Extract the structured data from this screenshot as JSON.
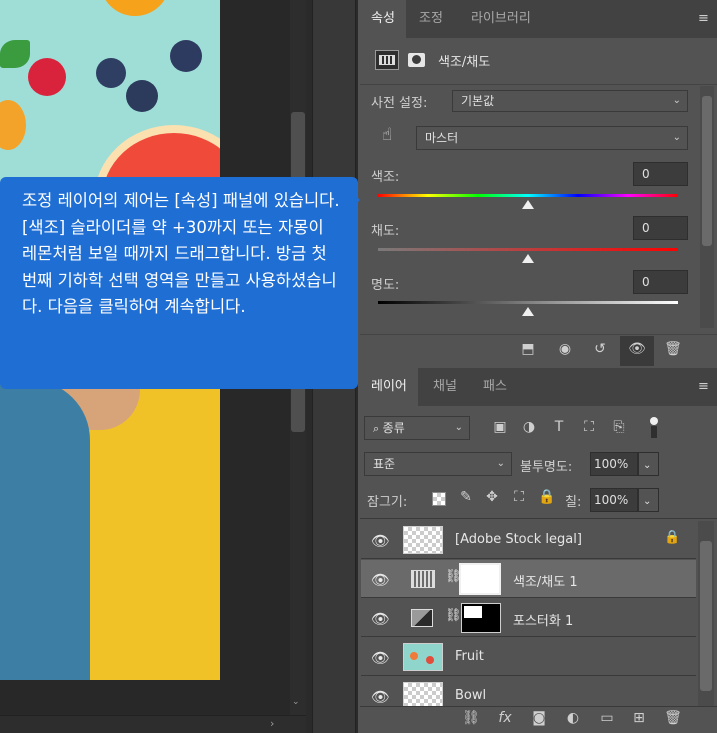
{
  "properties": {
    "tabs": [
      "속성",
      "조정",
      "라이브러리"
    ],
    "title": "색조/채도",
    "preset_label": "사전 설정:",
    "preset_value": "기본값",
    "channel_value": "마스터",
    "hue_label": "색조:",
    "hue_value": "0",
    "saturation_label": "채도:",
    "saturation_value": "0",
    "lightness_label": "명도:",
    "lightness_value": "0"
  },
  "layers_panel": {
    "tabs": [
      "레이어",
      "채널",
      "패스"
    ],
    "filter_value": "종류",
    "blend_mode": "표준",
    "opacity_label": "불투명도:",
    "opacity_value": "100%",
    "lock_label": "잠그기:",
    "fill_label": "칠:",
    "fill_value": "100%",
    "layers": [
      {
        "name": "[Adobe Stock legal]"
      },
      {
        "name": "색조/채도 1"
      },
      {
        "name": "포스터화 1"
      },
      {
        "name": "Fruit"
      },
      {
        "name": "Bowl"
      }
    ]
  },
  "tooltip": {
    "text": "조정 레이어의 제어는 [속성] 패널에 있습니다. [색조] 슬라이더를 약 +30까지 또는 자몽이 레몬처럼 보일 때까지 드래그합니다. 방금 첫 번째 기하학 선택 영역을 만들고 사용하셨습니다. 다음을 클릭하여 계속합니다."
  },
  "icons": {
    "menu": "hamburger-menu-icon",
    "eye": "eye-icon",
    "lock": "lock-icon",
    "link": "chain-link-icon"
  },
  "colors": {
    "tooltip_bg": "#1f6ed4",
    "panel_bg": "#535353",
    "tab_bar_bg": "#424242"
  }
}
